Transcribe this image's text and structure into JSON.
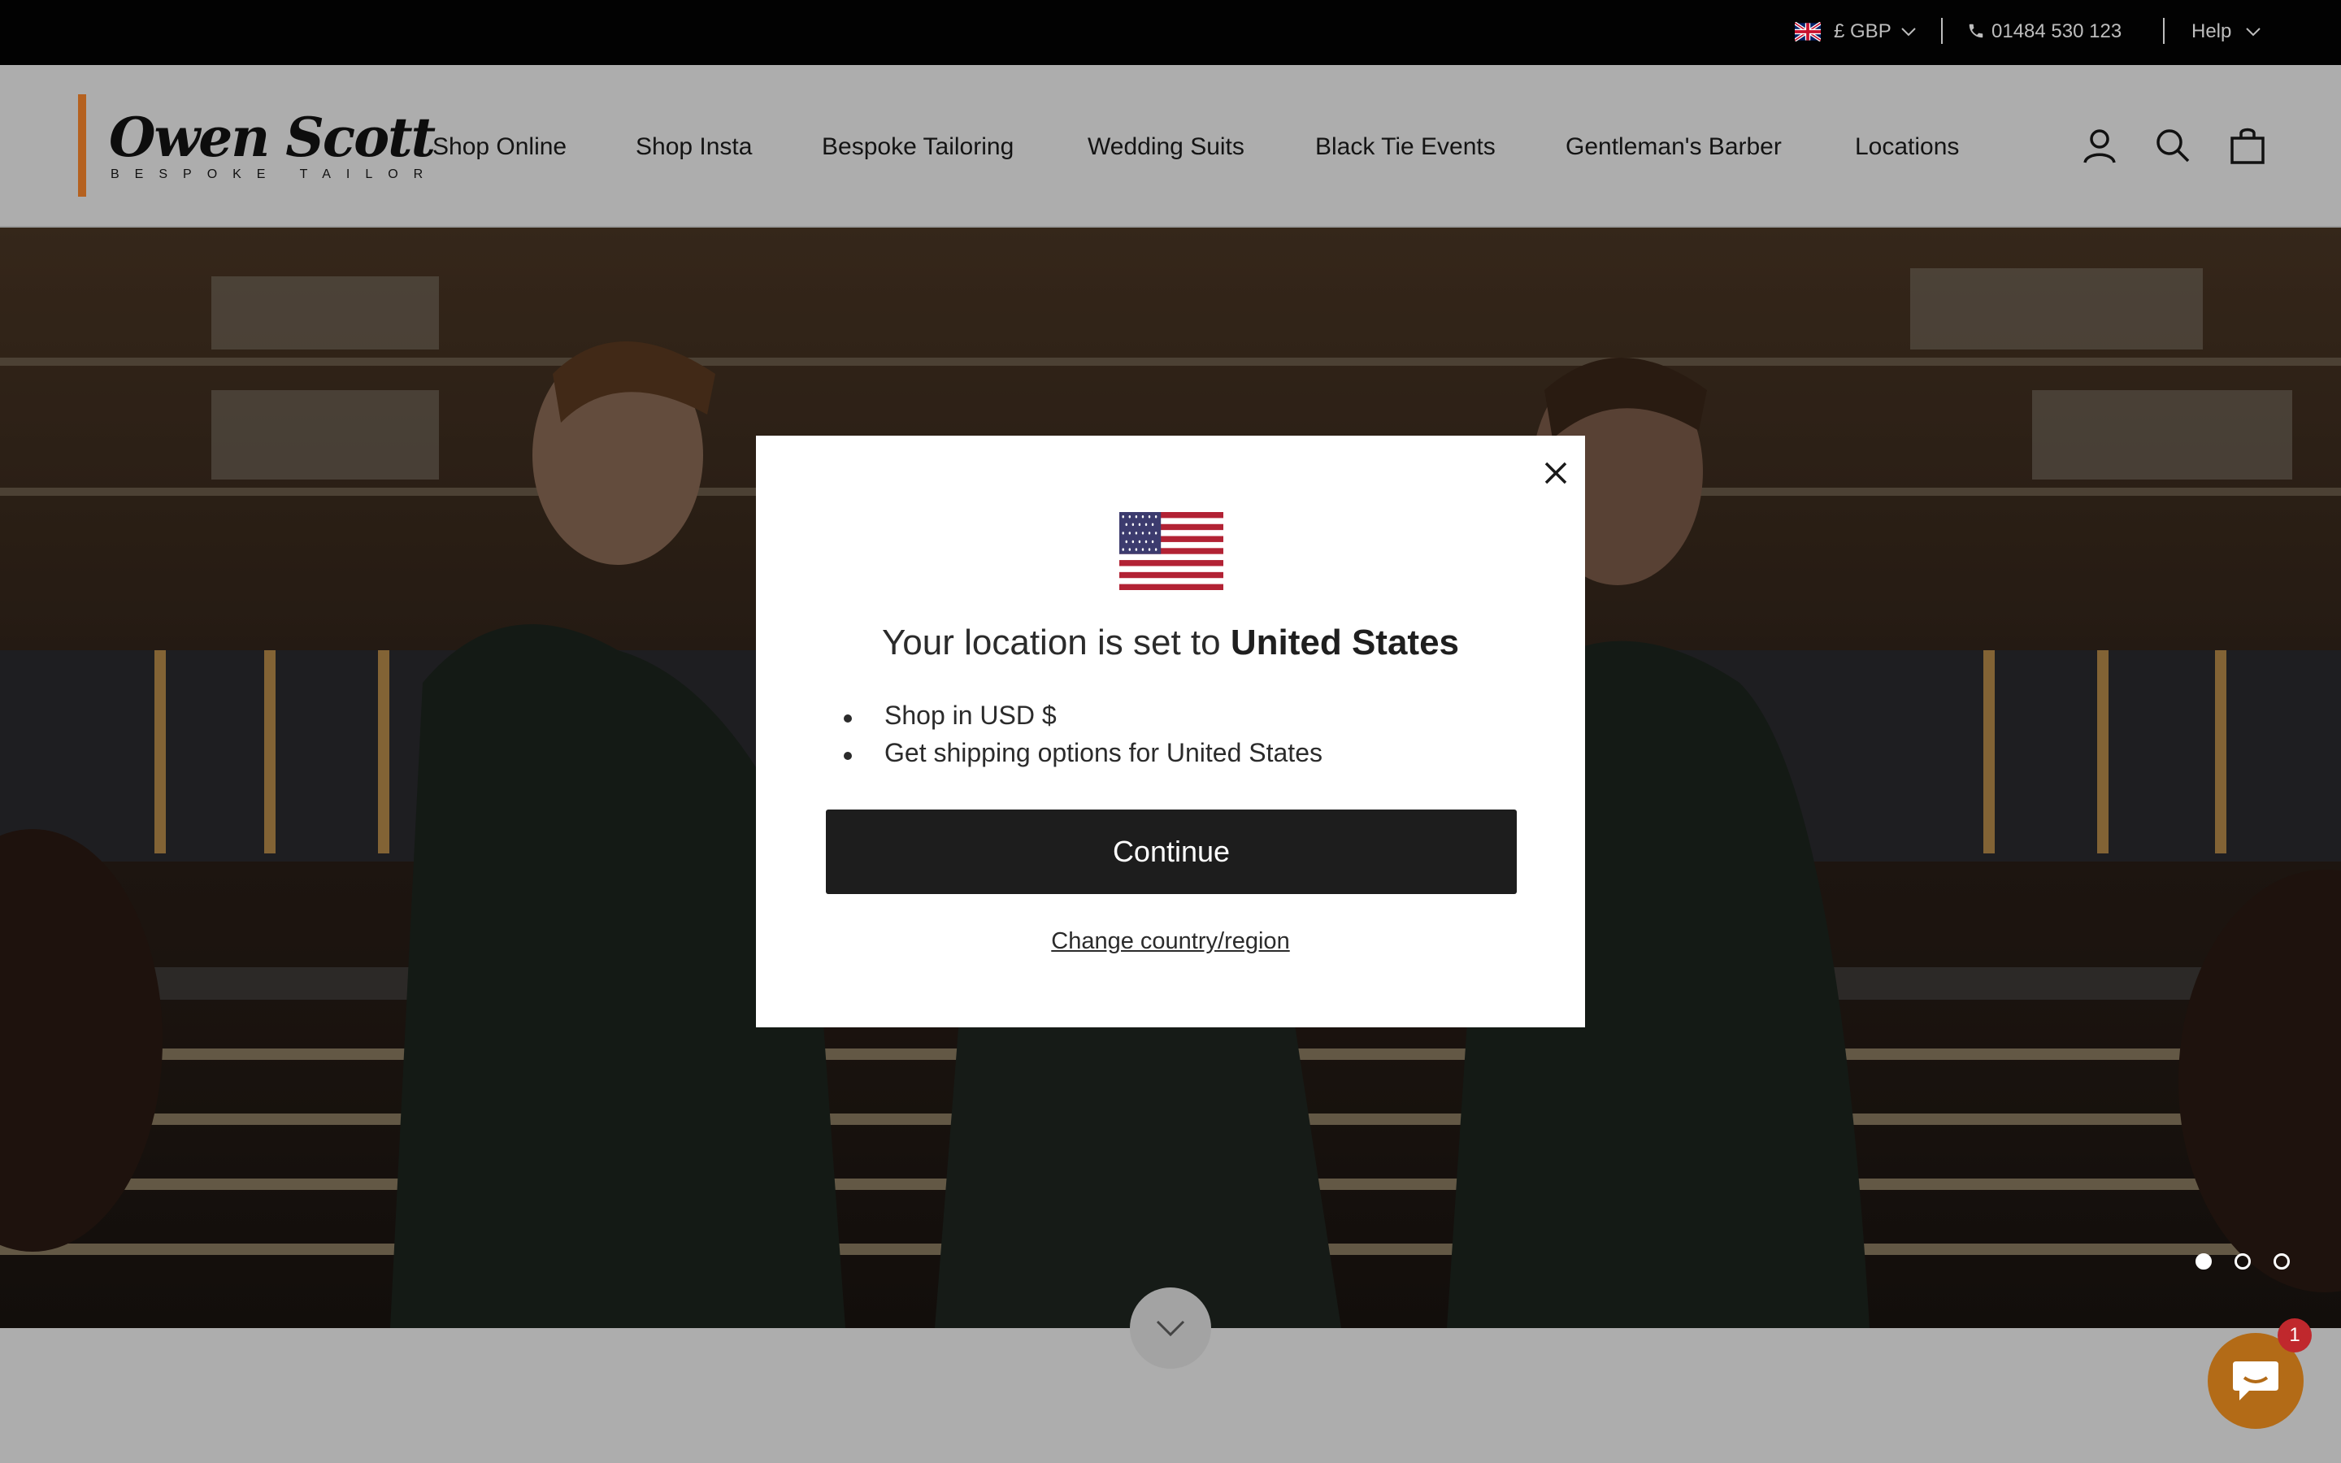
{
  "topbar": {
    "currency": "£ GBP",
    "phone": "01484 530 123",
    "help": "Help"
  },
  "header": {
    "logo_name": "Owen Scott",
    "logo_sub": "BESPOKE TAILOR",
    "nav": [
      "Shop Online",
      "Shop Insta",
      "Bespoke Tailoring",
      "Wedding Suits",
      "Black Tie Events",
      "Gentleman's Barber",
      "Locations"
    ],
    "icons": [
      "account-icon",
      "search-icon",
      "bag-icon"
    ]
  },
  "hero": {
    "slide_count": 3,
    "active_slide": 1
  },
  "modal": {
    "title_prefix": "Your location is set to ",
    "title_country": "United States",
    "bullets": [
      "Shop in USD $",
      "Get shipping options for United States"
    ],
    "continue_label": "Continue",
    "change_label": "Change country/region"
  },
  "chat": {
    "badge_count": "1"
  },
  "colors": {
    "topbar_bg": "#020202",
    "logo_accent": "#b5611f",
    "button_dark": "#1d1d1d",
    "chat_orange": "#b36b17",
    "badge_red": "#c0282d"
  }
}
